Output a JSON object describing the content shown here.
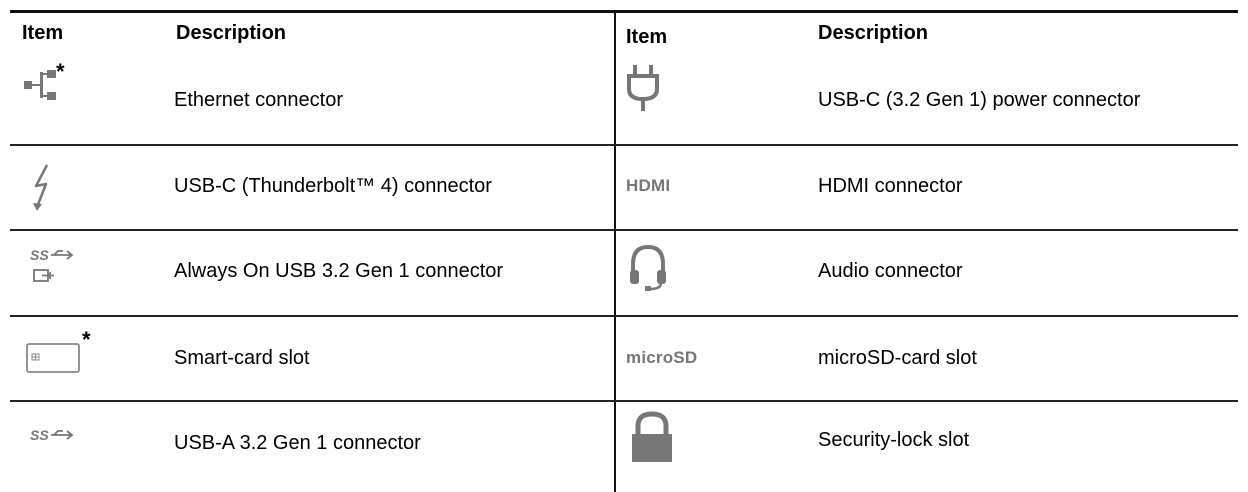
{
  "table": {
    "headers": {
      "item_left": "Item",
      "description_left": "Description",
      "item_right": "Item",
      "description_right": "Description"
    },
    "rows": [
      {
        "left": {
          "icon": "ethernet-icon",
          "asterisk": "*",
          "description": "Ethernet connector"
        },
        "right": {
          "icon": "power-plug-icon",
          "description": "USB-C (3.2 Gen 1) power connector"
        }
      },
      {
        "left": {
          "icon": "thunderbolt-icon",
          "description": "USB-C (Thunderbolt™ 4) connector"
        },
        "right": {
          "icon": "hdmi-icon",
          "icon_text": "HDMI",
          "description": "HDMI connector"
        }
      },
      {
        "left": {
          "icon": "usb-ss-charging-icon",
          "icon_text": "SS",
          "description": "Always On USB 3.2 Gen 1 connector"
        },
        "right": {
          "icon": "headset-icon",
          "description": "Audio connector"
        }
      },
      {
        "left": {
          "icon": "smart-card-icon",
          "asterisk": "*",
          "description": "Smart-card slot"
        },
        "right": {
          "icon": "microsd-icon",
          "icon_text": "microSD",
          "description": "microSD-card slot"
        }
      },
      {
        "left": {
          "icon": "usb-ss-icon",
          "icon_text": "SS",
          "description": "USB-A 3.2 Gen 1 connector"
        },
        "right": {
          "icon": "lock-icon",
          "description": "Security-lock slot"
        }
      }
    ],
    "colors": {
      "rule": "#111111",
      "icon_gray": "#777777"
    }
  }
}
